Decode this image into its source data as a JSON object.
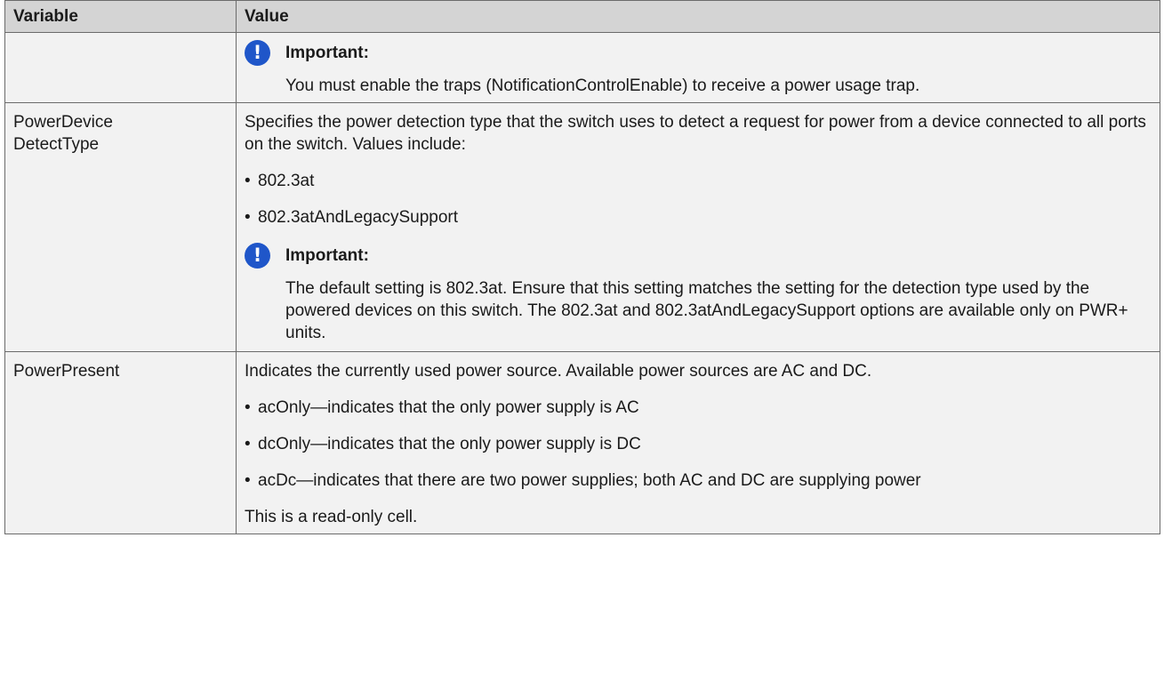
{
  "table": {
    "headers": {
      "variable": "Variable",
      "value": "Value"
    },
    "row0": {
      "variable": "",
      "important_title": "Important:",
      "important_text": "You must enable the traps (NotificationControlEnable) to receive a power usage trap."
    },
    "row1": {
      "variable_line1": "PowerDevice",
      "variable_line2": "DetectType",
      "description": "Specifies the power detection type that the switch uses to detect a request for power from a device connected to all ports on the switch. Values include:",
      "bullets": [
        "802.3at",
        "802.3atAndLegacySupport"
      ],
      "important_title": "Important:",
      "important_text": "The default setting is 802.3at. Ensure that this setting matches the setting for the detection type used by the powered devices on this switch. The 802.3at and 802.3atAndLegacySupport options are available only on PWR+ units."
    },
    "row2": {
      "variable": "PowerPresent",
      "description": "Indicates the currently used power source. Available power sources are AC and DC.",
      "bullets": [
        "acOnly—indicates that the only power supply is AC",
        "dcOnly—indicates that the only power supply is DC",
        "acDc—indicates that there are two power supplies; both AC and DC are supplying power"
      ],
      "note": "This is a read-only cell."
    }
  },
  "icons": {
    "important": "exclamation-circle-icon",
    "bullet": "bullet-dot"
  },
  "colors": {
    "header_bg": "#d4d4d4",
    "cell_bg": "#f2f2f2",
    "icon_blue": "#1f56c9",
    "border": "#6b6b6b"
  }
}
